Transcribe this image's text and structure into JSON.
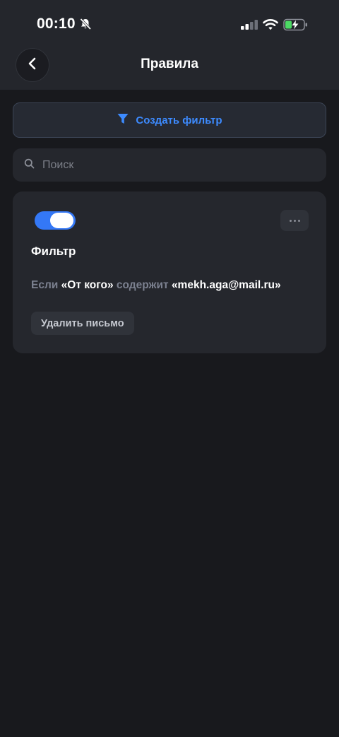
{
  "status_bar": {
    "time": "00:10",
    "icons": [
      "bell-slash-icon",
      "cellular-signal-icon",
      "wifi-icon",
      "battery-charging-icon"
    ]
  },
  "header": {
    "title": "Правила",
    "back_icon": "chevron-left-icon"
  },
  "create_filter": {
    "label": "Создать фильтр",
    "icon": "funnel-icon"
  },
  "search": {
    "placeholder": "Поиск",
    "value": "",
    "icon": "search-icon"
  },
  "filter_card": {
    "enabled": true,
    "name": "Фильтр",
    "condition": {
      "prefix": "Если",
      "field": "«От кого»",
      "operator": "содержит",
      "value": "«mekh.aga@mail.ru»"
    },
    "action": "Удалить письмо",
    "more_icon": "more-horizontal-icon"
  },
  "colors": {
    "accent": "#3478f6",
    "link": "#3d8bff",
    "background": "#18191d",
    "surface": "#25272d",
    "battery_charge": "#4cd964"
  }
}
